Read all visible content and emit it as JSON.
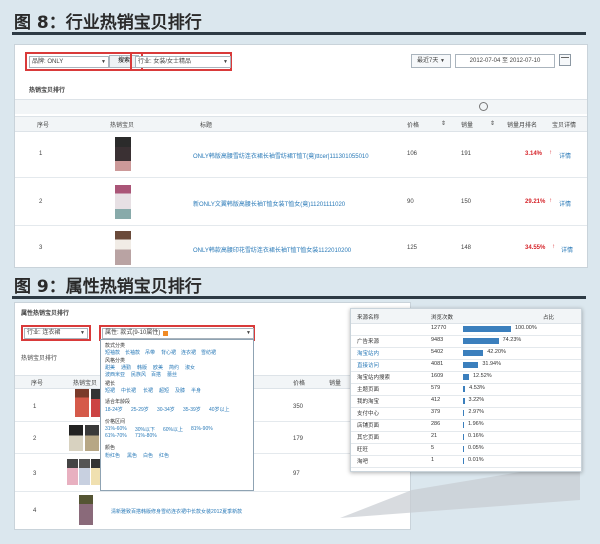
{
  "fig8": {
    "title": "图 8：行业热销宝贝排行",
    "brand_label": "品牌: ONLY",
    "search_button": "搜索",
    "industry_label": "行业: 女装/女士精品",
    "period": "最近7天",
    "date_range": "2012-07-04 至 2012-07-10",
    "section_title": "热销宝贝排行",
    "columns": [
      "序号",
      "热销宝贝",
      "标题",
      "价格",
      "销量",
      "销量月排名",
      "宝贝详情"
    ],
    "rows": [
      {
        "rank": "1",
        "title": "ONLY韩版高腰雪纺连衣裙长袖雪纺裙T恤T(竟)ttcer|111301055010",
        "price": "106",
        "sales": "191",
        "pct": "3.14%",
        "detail": "详情"
      },
      {
        "rank": "2",
        "title": "新ONLY文翼韩版高腰长袖T恤女装T恤女(竟)11201111020",
        "price": "90",
        "sales": "150",
        "pct": "29.21%",
        "detail": "详情"
      },
      {
        "rank": "3",
        "title": "ONLY韩款高腰印花雪纺连衣裙长袖T恤T恤女装1122010200",
        "price": "125",
        "sales": "148",
        "pct": "34.55%",
        "detail": "详情"
      }
    ]
  },
  "fig9": {
    "title": "图 9：属性热销宝贝排行",
    "panel_title": "属性热销宝贝排行",
    "industry_select": "行业: 连衣裙",
    "attr_select": "属性: 款式(9-10属性)",
    "section_title": "热销宝贝排行",
    "columns": [
      "序号",
      "热销宝贝",
      "价格",
      "销量"
    ],
    "rows": [
      {
        "rank": "1",
        "price": "",
        "sales": "350"
      },
      {
        "rank": "2",
        "price": "",
        "sales": "179"
      },
      {
        "rank": "3",
        "price": "",
        "sales": "97"
      },
      {
        "rank": "4",
        "price": "",
        "sales": "",
        "title": "清新雅致百搭韩版修身雪纺连衣裙中长款女装2012夏季新款"
      }
    ],
    "menu_groups": [
      {
        "name": "款式分类",
        "tags": [
          "短袖款",
          "长袖款",
          "吊带",
          "背心裙",
          "连衣裙",
          "雪纺裙"
        ]
      },
      {
        "name": "风格分类",
        "tags": [
          "甜美",
          "通勤",
          "韩版",
          "欧美",
          "简约",
          "淑女",
          "波西米亚",
          "民族风",
          "百搭",
          "蕾丝"
        ]
      },
      {
        "name": "裙长",
        "tags": [
          "短裙",
          "中长裙",
          "长裙",
          "超短",
          "及膝",
          "半身"
        ]
      },
      {
        "name": "适合年龄段",
        "tags": [
          "18-24岁",
          "25-29岁",
          "30-34岁",
          "35-39岁",
          "40岁以上"
        ]
      },
      {
        "name": "价格区间",
        "tags": [
          "31%-60%",
          "30%以下",
          "60%以上",
          "61%-70%",
          "81%-90%",
          "71%-80%"
        ]
      },
      {
        "name": "颜色",
        "tags": [
          "粉红色",
          "黑色",
          "白色",
          "红色"
        ]
      }
    ]
  },
  "source_table": {
    "columns": [
      "来源名称",
      "浏览次数",
      "占比"
    ],
    "rows": [
      {
        "name": "",
        "views": "12770",
        "pct": "100.00%",
        "frac": 1.0
      },
      {
        "name": "广告来源",
        "views": "9483",
        "pct": "74.23%",
        "frac": 0.7423
      },
      {
        "name": "淘宝站内",
        "views": "5402",
        "pct": "42.20%",
        "frac": 0.422
      },
      {
        "name": "直接访问",
        "views": "4081",
        "pct": "31.94%",
        "frac": 0.3194
      },
      {
        "name": "淘宝站内搜索",
        "views": "1609",
        "pct": "12.52%",
        "frac": 0.1252
      },
      {
        "name": "主题页面",
        "views": "579",
        "pct": "4.53%",
        "frac": 0.0453
      },
      {
        "name": "我的淘宝",
        "views": "412",
        "pct": "3.22%",
        "frac": 0.0322
      },
      {
        "name": "支付中心",
        "views": "379",
        "pct": "2.97%",
        "frac": 0.0297
      },
      {
        "name": "店铺页面",
        "views": "286",
        "pct": "1.96%",
        "frac": 0.0196
      },
      {
        "name": "其它页面",
        "views": "21",
        "pct": "0.16%",
        "frac": 0.0016
      },
      {
        "name": "旺旺",
        "views": "5",
        "pct": "0.05%",
        "frac": 0.0005
      },
      {
        "name": "淘吧",
        "views": "1",
        "pct": "0.01%",
        "frac": 0.0001
      }
    ]
  }
}
